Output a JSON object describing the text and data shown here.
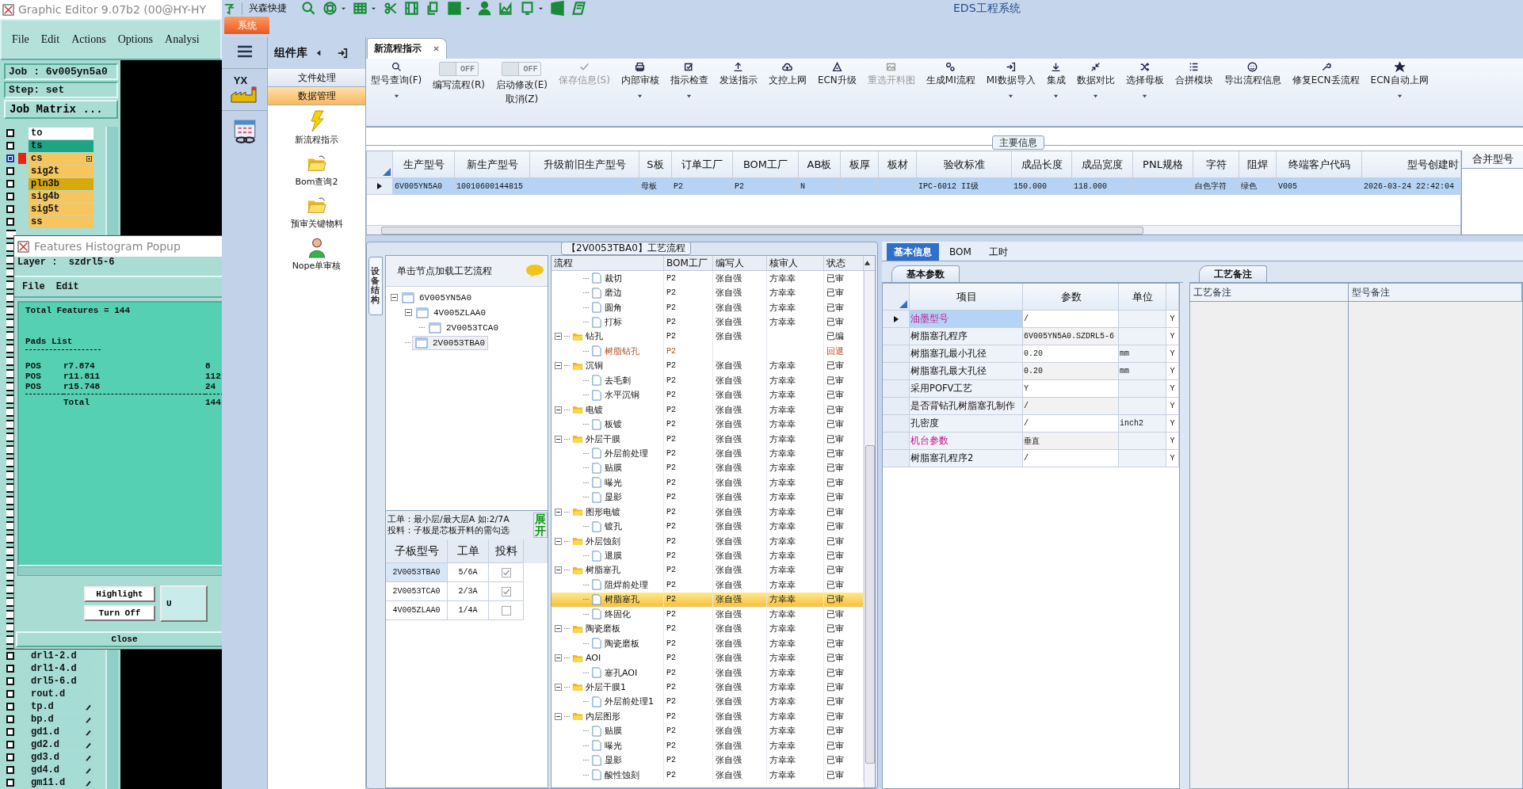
{
  "editor": {
    "title": "Graphic Editor 9.07b2 (00@HY-HY",
    "menu": [
      "File",
      "Edit",
      "Actions",
      "Options",
      "Analysi"
    ],
    "job": "Job : 6v005yn5a0",
    "step": "Step: set",
    "matrix_button": "Job Matrix ...",
    "layers_top": [
      {
        "name": "to",
        "color": "#ffffff",
        "selected": false
      },
      {
        "name": "ts",
        "color": "#1ea383",
        "selected": false
      },
      {
        "name": "cs",
        "color": "#f7c55e",
        "selected": true
      },
      {
        "name": "sig2t",
        "color": "#f7c55e",
        "selected": false
      },
      {
        "name": "pln3b",
        "color": "#d9a90c",
        "selected": false
      },
      {
        "name": "sig4b",
        "color": "#f7c55e",
        "selected": false
      },
      {
        "name": "sig5t",
        "color": "#f7c55e",
        "selected": false
      },
      {
        "name": "ss",
        "color": "#f7c55e",
        "selected": false
      }
    ],
    "layers_bottom": [
      {
        "name": "drl1-2.d",
        "color": "#a6dcd6",
        "selected": false,
        "editable": false
      },
      {
        "name": "drl1-4.d",
        "color": "#a6dcd6",
        "selected": false,
        "editable": false
      },
      {
        "name": "drl5-6.d",
        "color": "#a6dcd6",
        "selected": false,
        "editable": false
      },
      {
        "name": "rout.d",
        "color": "#a6dcd6",
        "selected": false,
        "editable": false
      },
      {
        "name": "tp.d",
        "color": "#a6dcd6",
        "selected": false,
        "editable": true
      },
      {
        "name": "bp.d",
        "color": "#a6dcd6",
        "selected": false,
        "editable": true
      },
      {
        "name": "gd1.d",
        "color": "#a6dcd6",
        "selected": false,
        "editable": true
      },
      {
        "name": "gd2.d",
        "color": "#a6dcd6",
        "selected": false,
        "editable": true
      },
      {
        "name": "gd3.d",
        "color": "#a6dcd6",
        "selected": false,
        "editable": true
      },
      {
        "name": "gd4.d",
        "color": "#a6dcd6",
        "selected": false,
        "editable": true
      },
      {
        "name": "gm11.d",
        "color": "#a6dcd6",
        "selected": false,
        "editable": true
      }
    ],
    "popup": {
      "title": "Features Histogram Popup",
      "layer": "Layer :  szdrl5-6",
      "menu": [
        "File",
        "Edit"
      ],
      "summary": "Total Features = 144",
      "section": "Pads List",
      "rows": [
        {
          "type": "POS",
          "symbol": "r7.874",
          "count": "8"
        },
        {
          "type": "POS",
          "symbol": "r11.811",
          "count": "112"
        },
        {
          "type": "POS",
          "symbol": "r15.748",
          "count": "24"
        }
      ],
      "total_label": "Total",
      "total": "144",
      "buttons": [
        "Highlight",
        "Turn Off"
      ],
      "side_button": "U",
      "close": "Close"
    }
  },
  "app": {
    "title": "EDS工程系统",
    "quick_label": "兴森快捷",
    "system_tab": "系统",
    "rail_logo": "YX",
    "library_title": "组件库",
    "sections": [
      {
        "label": "文件处理",
        "selected": false
      },
      {
        "label": "数据管理",
        "selected": true
      }
    ],
    "library_items": [
      "新流程指示",
      "Bom查询2",
      "预审关键物料",
      "Nope单审核"
    ],
    "doc_tab": "新流程指示"
  },
  "ribbon": [
    {
      "kind": "button",
      "label": "型号查询(F)",
      "dropdown": true,
      "disabled": false
    },
    {
      "kind": "toggle",
      "label": "编写流程(R)",
      "switch": "OFF",
      "on": false
    },
    {
      "kind": "toggle",
      "label": "启动修改(E)",
      "sublabel": "取消(Z)",
      "switch": "OFF",
      "on": false
    },
    {
      "kind": "button",
      "label": "保存信息(S)",
      "dropdown": false,
      "disabled": true
    },
    {
      "kind": "button",
      "label": "内部审核",
      "dropdown": true,
      "disabled": false
    },
    {
      "kind": "button",
      "label": "指示检查",
      "dropdown": true,
      "disabled": false
    },
    {
      "kind": "button",
      "label": "发送指示",
      "dropdown": false,
      "disabled": false
    },
    {
      "kind": "button",
      "label": "文控上网",
      "dropdown": false,
      "disabled": false
    },
    {
      "kind": "button",
      "label": "ECN升级",
      "dropdown": false,
      "disabled": false
    },
    {
      "kind": "button",
      "label": "重选开料图",
      "dropdown": false,
      "disabled": true
    },
    {
      "kind": "button",
      "label": "生成MI流程",
      "dropdown": false,
      "disabled": false
    },
    {
      "kind": "button",
      "label": "MI数据导入",
      "dropdown": true,
      "disabled": false
    },
    {
      "kind": "button",
      "label": "集成",
      "dropdown": true,
      "disabled": false
    },
    {
      "kind": "button",
      "label": "数据对比",
      "dropdown": true,
      "disabled": false
    },
    {
      "kind": "button",
      "label": "选择母板",
      "dropdown": true,
      "disabled": false
    },
    {
      "kind": "button",
      "label": "合拼模块",
      "dropdown": false,
      "disabled": false
    },
    {
      "kind": "button",
      "label": "导出流程信息",
      "dropdown": false,
      "disabled": false
    },
    {
      "kind": "button",
      "label": "修复ECN丢流程",
      "dropdown": false,
      "disabled": false
    },
    {
      "kind": "button",
      "label": "ECN自动上网",
      "dropdown": true,
      "disabled": false
    }
  ],
  "main_info": {
    "label": "主要信息",
    "columns": [
      "生产型号",
      "新生产型号",
      "升级前旧生产型号",
      "S板",
      "订单工厂",
      "BOM工厂",
      "AB板",
      "板厚",
      "板材",
      "验收标准",
      "成品长度",
      "成品宽度",
      "PNL规格",
      "字符",
      "阻焊",
      "终端客户代码",
      "型号创建时"
    ],
    "rows": [
      {
        "selected": true,
        "cells": [
          "6V005YN5A0",
          "10010600144815",
          null,
          "母板",
          "P2",
          "P2",
          "N",
          null,
          null,
          "IPC-6012 II级",
          "150.000",
          "118.000",
          null,
          "白色字符",
          "绿色",
          "V005",
          "2026-03-24 22:42:04"
        ]
      }
    ],
    "side_title": "合并型号"
  },
  "structure": {
    "side_tab": "设备结构",
    "hint": "单击节点加载工艺流程",
    "tree": [
      {
        "label": "6V005YN5A0",
        "selected": false,
        "expanded": true,
        "children": [
          {
            "label": "4V005ZLAA0",
            "selected": false,
            "expanded": true,
            "children": [
              {
                "label": "2V0053TCA0",
                "selected": false
              }
            ]
          },
          {
            "label": "2V0053TBA0",
            "selected": true
          }
        ]
      }
    ],
    "notes": [
      "工单：最小层/最大层A 如:2/7A",
      "投料：子板是芯板开料的需勾选"
    ],
    "expand_button": "展开",
    "columns": [
      "子板型号",
      "工单",
      "投料"
    ],
    "rows": [
      {
        "model": "2V0053TBA0",
        "order": "5/6A",
        "feed": true,
        "selected": true
      },
      {
        "model": "2V0053TCA0",
        "order": "2/3A",
        "feed": true,
        "selected": false
      },
      {
        "model": "4V005ZLAA0",
        "order": "1/4A",
        "feed": false,
        "selected": false
      }
    ]
  },
  "flow": {
    "title": "【2V0053TBA0】工艺流程",
    "columns": [
      "流程",
      "BOM工厂",
      "编写人",
      "核审人",
      "状态"
    ],
    "rows": [
      {
        "kind": "doc",
        "name": "裁切",
        "bom": "P2",
        "author": "张自强",
        "reviewer": "方幸幸",
        "status": "已审",
        "returned": false,
        "selected": false
      },
      {
        "kind": "doc",
        "name": "磨边",
        "bom": "P2",
        "author": "张自强",
        "reviewer": "方幸幸",
        "status": "已审",
        "returned": false,
        "selected": false
      },
      {
        "kind": "doc",
        "name": "圆角",
        "bom": "P2",
        "author": "张自强",
        "reviewer": "方幸幸",
        "status": "已审",
        "returned": false,
        "selected": false
      },
      {
        "kind": "doc",
        "name": "打标",
        "bom": "P2",
        "author": "张自强",
        "reviewer": "方幸幸",
        "status": "已审",
        "returned": false,
        "selected": false
      },
      {
        "kind": "folder",
        "name": "钻孔",
        "bom": "P2",
        "author": "张自强",
        "status": "已编",
        "returned": false,
        "selected": false,
        "expanded": true,
        "children": [
          {
            "kind": "doc",
            "name": "树脂钻孔",
            "bom": "P2",
            "status": "回退",
            "returned": true,
            "selected": false
          }
        ]
      },
      {
        "kind": "folder",
        "name": "沉铜",
        "bom": "P2",
        "author": "张自强",
        "reviewer": "方幸幸",
        "status": "已审",
        "returned": false,
        "selected": false,
        "expanded": true,
        "children": [
          {
            "kind": "doc",
            "name": "去毛刺",
            "bom": "P2",
            "author": "张自强",
            "reviewer": "方幸幸",
            "status": "已审",
            "returned": false,
            "selected": false
          },
          {
            "kind": "doc",
            "name": "水平沉铜",
            "bom": "P2",
            "author": "张自强",
            "reviewer": "方幸幸",
            "status": "已审",
            "returned": false,
            "selected": false
          }
        ]
      },
      {
        "kind": "folder",
        "name": "电镀",
        "bom": "P2",
        "author": "张自强",
        "reviewer": "方幸幸",
        "status": "已审",
        "returned": false,
        "selected": false,
        "expanded": true,
        "children": [
          {
            "kind": "doc",
            "name": "板镀",
            "bom": "P2",
            "author": "张自强",
            "reviewer": "方幸幸",
            "status": "已审",
            "returned": false,
            "selected": false
          }
        ]
      },
      {
        "kind": "folder",
        "name": "外层干膜",
        "bom": "P2",
        "author": "张自强",
        "reviewer": "方幸幸",
        "status": "已审",
        "returned": false,
        "selected": false,
        "expanded": true,
        "children": [
          {
            "kind": "doc",
            "name": "外层前处理",
            "bom": "P2",
            "author": "张自强",
            "reviewer": "方幸幸",
            "status": "已审",
            "returned": false,
            "selected": false
          },
          {
            "kind": "doc",
            "name": "贴膜",
            "bom": "P2",
            "author": "张自强",
            "reviewer": "方幸幸",
            "status": "已审",
            "returned": false,
            "selected": false
          },
          {
            "kind": "doc",
            "name": "曝光",
            "bom": "P2",
            "author": "张自强",
            "reviewer": "方幸幸",
            "status": "已审",
            "returned": false,
            "selected": false
          },
          {
            "kind": "doc",
            "name": "显影",
            "bom": "P2",
            "author": "张自强",
            "reviewer": "方幸幸",
            "status": "已审",
            "returned": false,
            "selected": false
          }
        ]
      },
      {
        "kind": "folder",
        "name": "图形电镀",
        "bom": "P2",
        "author": "张自强",
        "reviewer": "方幸幸",
        "status": "已审",
        "returned": false,
        "selected": false,
        "expanded": true,
        "children": [
          {
            "kind": "doc",
            "name": "镀孔",
            "bom": "P2",
            "author": "张自强",
            "reviewer": "方幸幸",
            "status": "已审",
            "returned": false,
            "selected": false
          }
        ]
      },
      {
        "kind": "folder",
        "name": "外层蚀刻",
        "bom": "P2",
        "author": "张自强",
        "reviewer": "方幸幸",
        "status": "已审",
        "returned": false,
        "selected": false,
        "expanded": true,
        "children": [
          {
            "kind": "doc",
            "name": "退膜",
            "bom": "P2",
            "author": "张自强",
            "reviewer": "方幸幸",
            "status": "已审",
            "returned": false,
            "selected": false
          }
        ]
      },
      {
        "kind": "folder",
        "name": "树脂塞孔",
        "bom": "P2",
        "author": "张自强",
        "reviewer": "方幸幸",
        "status": "已审",
        "returned": false,
        "selected": false,
        "expanded": true,
        "children": [
          {
            "kind": "doc",
            "name": "阻焊前处理",
            "bom": "P2",
            "author": "张自强",
            "reviewer": "方幸幸",
            "status": "已审",
            "returned": false,
            "selected": false
          },
          {
            "kind": "doc",
            "name": "树脂塞孔",
            "bom": "P2",
            "author": "张自强",
            "reviewer": "方幸幸",
            "status": "已审",
            "returned": false,
            "selected": true
          },
          {
            "kind": "doc",
            "name": "终固化",
            "bom": "P2",
            "author": "张自强",
            "reviewer": "方幸幸",
            "status": "已审",
            "returned": false,
            "selected": false
          }
        ]
      },
      {
        "kind": "folder",
        "name": "陶瓷磨板",
        "bom": "P2",
        "author": "张自强",
        "reviewer": "方幸幸",
        "status": "已审",
        "returned": false,
        "selected": false,
        "expanded": true,
        "children": [
          {
            "kind": "doc",
            "name": "陶瓷磨板",
            "bom": "P2",
            "author": "张自强",
            "reviewer": "方幸幸",
            "status": "已审",
            "returned": false,
            "selected": false
          }
        ]
      },
      {
        "kind": "folder",
        "name": "AOI",
        "bom": "P2",
        "author": "张自强",
        "reviewer": "方幸幸",
        "status": "已审",
        "returned": false,
        "selected": false,
        "expanded": true,
        "children": [
          {
            "kind": "doc",
            "name": "塞孔AOI",
            "bom": "P2",
            "author": "张自强",
            "reviewer": "方幸幸",
            "status": "已审",
            "returned": false,
            "selected": false
          }
        ]
      },
      {
        "kind": "folder",
        "name": "外层干膜1",
        "bom": "P2",
        "author": "张自强",
        "reviewer": "方幸幸",
        "status": "已审",
        "returned": false,
        "selected": false,
        "expanded": true,
        "children": [
          {
            "kind": "doc",
            "name": "外层前处理1",
            "bom": "P2",
            "author": "张自强",
            "reviewer": "方幸幸",
            "status": "已审",
            "returned": false,
            "selected": false
          }
        ]
      },
      {
        "kind": "folder",
        "name": "内层图形",
        "bom": "P2",
        "author": "张自强",
        "reviewer": "方幸幸",
        "status": "已审",
        "returned": false,
        "selected": false,
        "expanded": true,
        "children": [
          {
            "kind": "doc",
            "name": "贴膜",
            "bom": "P2",
            "author": "张自强",
            "reviewer": "方幸幸",
            "status": "已审",
            "returned": false,
            "selected": false
          },
          {
            "kind": "doc",
            "name": "曝光",
            "bom": "P2",
            "author": "张自强",
            "reviewer": "方幸幸",
            "status": "已审",
            "returned": false,
            "selected": false
          },
          {
            "kind": "doc",
            "name": "显影",
            "bom": "P2",
            "author": "张自强",
            "reviewer": "方幸幸",
            "status": "已审",
            "returned": false,
            "selected": false
          },
          {
            "kind": "doc",
            "name": "酸性蚀刻",
            "bom": "P2",
            "author": "张自强",
            "reviewer": "方幸幸",
            "status": "已审",
            "returned": false,
            "selected": false
          }
        ]
      }
    ]
  },
  "details": {
    "tabs": [
      {
        "label": "基本信息",
        "selected": true
      },
      {
        "label": "BOM",
        "selected": false
      },
      {
        "label": "工时",
        "selected": false
      }
    ],
    "params_tab": "基本参数",
    "param_columns": [
      "项目",
      "参数",
      "单位"
    ],
    "params": [
      {
        "item": "油墨型号",
        "value": "/",
        "flag": "Y",
        "highlight": true,
        "selected": true
      },
      {
        "item": "树脂塞孔程序",
        "value": "6V005YN5A0.SZDRL5-6",
        "flag": "Y",
        "highlight": false,
        "selected": false
      },
      {
        "item": "树脂塞孔最小孔径",
        "value": "0.20",
        "unit": "mm",
        "flag": "Y",
        "highlight": false,
        "selected": false
      },
      {
        "item": "树脂塞孔最大孔径",
        "value": "0.20",
        "unit": "mm",
        "flag": "Y",
        "highlight": false,
        "selected": false
      },
      {
        "item": "采用POFV工艺",
        "value": "Y",
        "flag": "Y",
        "highlight": false,
        "selected": false
      },
      {
        "item": "是否背钻孔树脂塞孔制作",
        "value": "/",
        "flag": "Y",
        "highlight": false,
        "selected": false
      },
      {
        "item": "孔密度",
        "value": "/",
        "unit": "inch2",
        "flag": "Y",
        "highlight": false,
        "selected": false
      },
      {
        "item": "机台参数",
        "value": "垂直",
        "flag": "Y",
        "highlight": true,
        "selected": false
      },
      {
        "item": "树脂塞孔程序2",
        "value": "/",
        "flag": "Y",
        "highlight": false,
        "selected": false
      }
    ],
    "notes_tab": "工艺备注",
    "note_columns": [
      "工艺备注",
      "型号备注"
    ]
  }
}
